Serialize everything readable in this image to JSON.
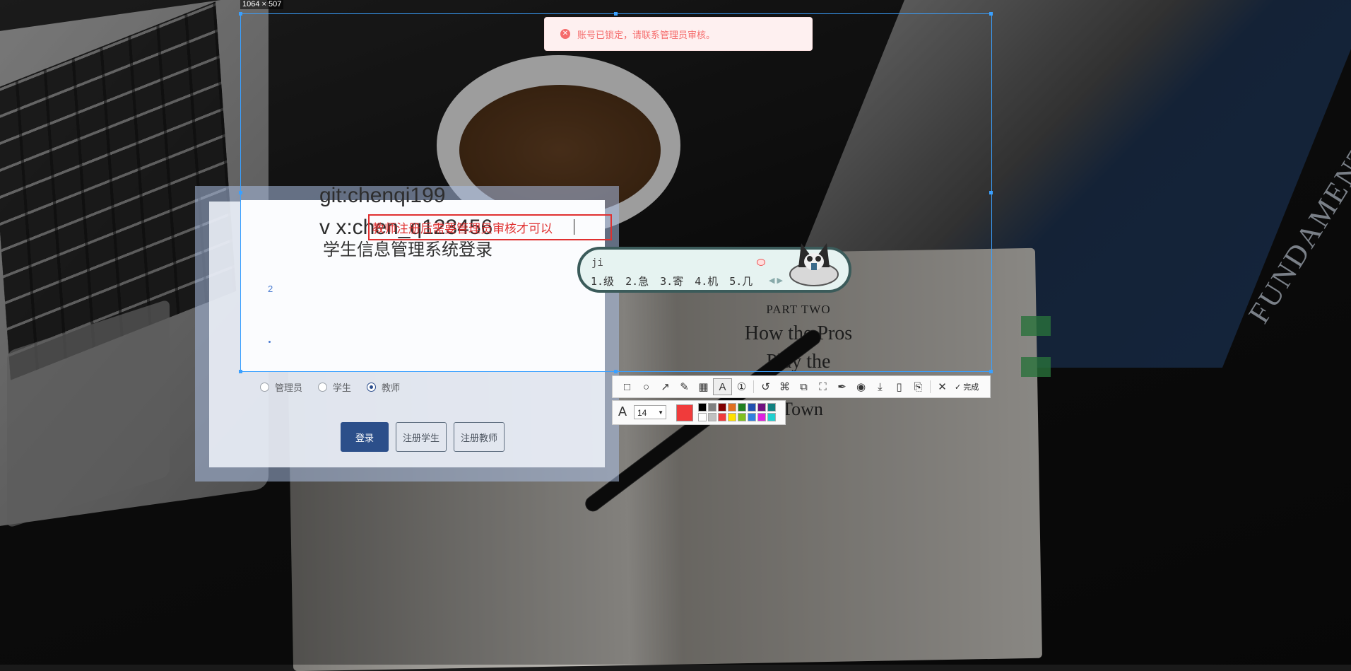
{
  "selection": {
    "size_label": "1064 × 507"
  },
  "toast": {
    "icon": "error-circle-icon",
    "message": "账号已锁定，请联系管理员审核。"
  },
  "annotations": {
    "line1": "git:chenqi199",
    "line2": "v x:chen_q123456",
    "box_text": "教师注册后需要管理员审核才可以"
  },
  "login": {
    "title": "学生信息管理系统登录",
    "field_marker": "2",
    "roles": [
      {
        "label": "管理员",
        "selected": false
      },
      {
        "label": "学生",
        "selected": false
      },
      {
        "label": "教师",
        "selected": true
      }
    ],
    "buttons": {
      "login": "登录",
      "register_student": "注册学生",
      "register_teacher": "注册教师"
    }
  },
  "ime": {
    "input": "ji",
    "candidates": [
      "1.级",
      "2.急",
      "3.寄",
      "4.机",
      "5.几"
    ],
    "arrows": "◀ ▶"
  },
  "background": {
    "book_part": "PART TWO",
    "book_heading_1": "How the Pros",
    "book_heading_2": "Play the",
    "book_heading_3": "Town",
    "cover_text": "FUNDAMENTALS"
  },
  "toolbar": {
    "tools": [
      {
        "name": "rectangle-tool",
        "glyph": "□"
      },
      {
        "name": "ellipse-tool",
        "glyph": "○"
      },
      {
        "name": "arrow-tool",
        "glyph": "↗"
      },
      {
        "name": "pen-tool",
        "glyph": "✎"
      },
      {
        "name": "mosaic-tool",
        "glyph": "▦"
      },
      {
        "name": "text-tool",
        "glyph": "A",
        "active": true
      },
      {
        "name": "number-tool",
        "glyph": "①"
      }
    ],
    "actions": [
      {
        "name": "undo-button",
        "glyph": "↺"
      },
      {
        "name": "ocr-button",
        "glyph": "⌘"
      },
      {
        "name": "translate-button",
        "glyph": "⧉"
      },
      {
        "name": "scan-button",
        "glyph": "⛶"
      },
      {
        "name": "pin-button",
        "glyph": "✒"
      },
      {
        "name": "record-button",
        "glyph": "◉"
      },
      {
        "name": "save-button",
        "glyph": "⤓"
      },
      {
        "name": "phone-button",
        "glyph": "▯"
      },
      {
        "name": "bookmark-button",
        "glyph": "⎘"
      }
    ],
    "cancel_glyph": "✕",
    "done_glyph": "✓",
    "done_label": "完成"
  },
  "text_panel": {
    "font_size": "14",
    "current_color": "#f03b3b",
    "palette": [
      "#000000",
      "#808080",
      "#800000",
      "#e07020",
      "#208020",
      "#2050b0",
      "#701080",
      "#108080",
      "#ffffff",
      "#c0c0c0",
      "#f03b3b",
      "#ffe000",
      "#80c020",
      "#3080e0",
      "#e020e0",
      "#20d0d0"
    ]
  }
}
